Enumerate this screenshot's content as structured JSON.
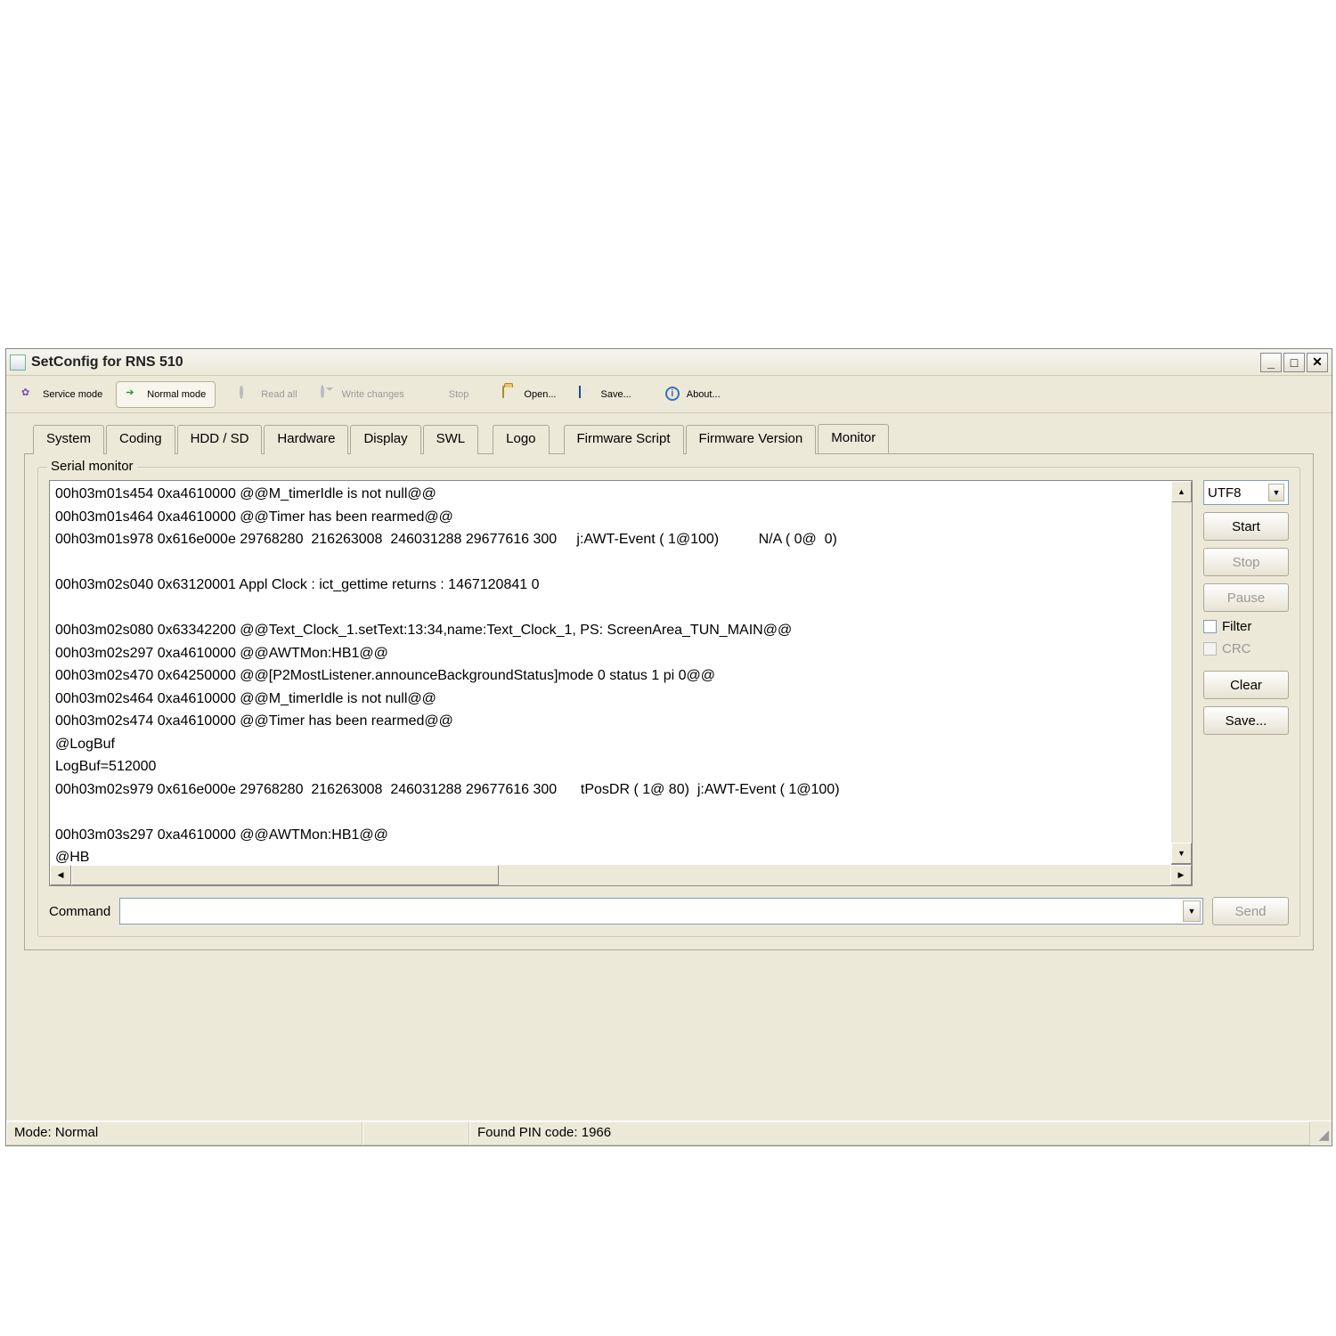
{
  "window": {
    "title": "SetConfig for RNS 510"
  },
  "toolbar": {
    "service_mode": "Service mode",
    "normal_mode": "Normal mode",
    "read_all": "Read all",
    "write_changes": "Write changes",
    "stop": "Stop",
    "open": "Open...",
    "save": "Save...",
    "about": "About..."
  },
  "tabs": [
    "System",
    "Coding",
    "HDD / SD",
    "Hardware",
    "Display",
    "SWL",
    "Logo",
    "Firmware Script",
    "Firmware Version",
    "Monitor"
  ],
  "active_tab": "Monitor",
  "panel": {
    "fieldset_label": "Serial monitor",
    "encoding": "UTF8",
    "buttons": {
      "start": "Start",
      "stop": "Stop",
      "pause": "Pause",
      "clear": "Clear",
      "save": "Save...",
      "send": "Send"
    },
    "checkboxes": {
      "filter": "Filter",
      "crc": "CRC"
    },
    "command_label": "Command",
    "command_value": ""
  },
  "monitor_lines": [
    "00h03m01s454 0xa4610000 @@M_timerIdle is not null@@",
    "00h03m01s464 0xa4610000 @@Timer has been rearmed@@",
    "00h03m01s978 0x616e000e 29768280  216263008  246031288 29677616 300     j:AWT-Event ( 1@100)          N/A ( 0@  0)",
    "",
    "00h03m02s040 0x63120001 Appl Clock : ict_gettime returns : 1467120841 0",
    "",
    "00h03m02s080 0x63342200 @@Text_Clock_1.setText:13:34,name:Text_Clock_1, PS: ScreenArea_TUN_MAIN@@",
    "00h03m02s297 0xa4610000 @@AWTMon:HB1@@",
    "00h03m02s470 0x64250000 @@[P2MostListener.announceBackgroundStatus]mode 0 status 1 pi 0@@",
    "00h03m02s464 0xa4610000 @@M_timerIdle is not null@@",
    "00h03m02s474 0xa4610000 @@Timer has been rearmed@@",
    "@LogBuf",
    "LogBuf=512000",
    "00h03m02s979 0x616e000e 29768280  216263008  246031288 29677616 300      tPosDR ( 1@ 80)  j:AWT-Event ( 1@100)",
    "",
    "00h03m03s297 0xa4610000 @@AWTMon:HB1@@",
    "@HB"
  ],
  "statusbar": {
    "mode": "Mode: Normal",
    "pin": "Found PIN code: 1966"
  }
}
